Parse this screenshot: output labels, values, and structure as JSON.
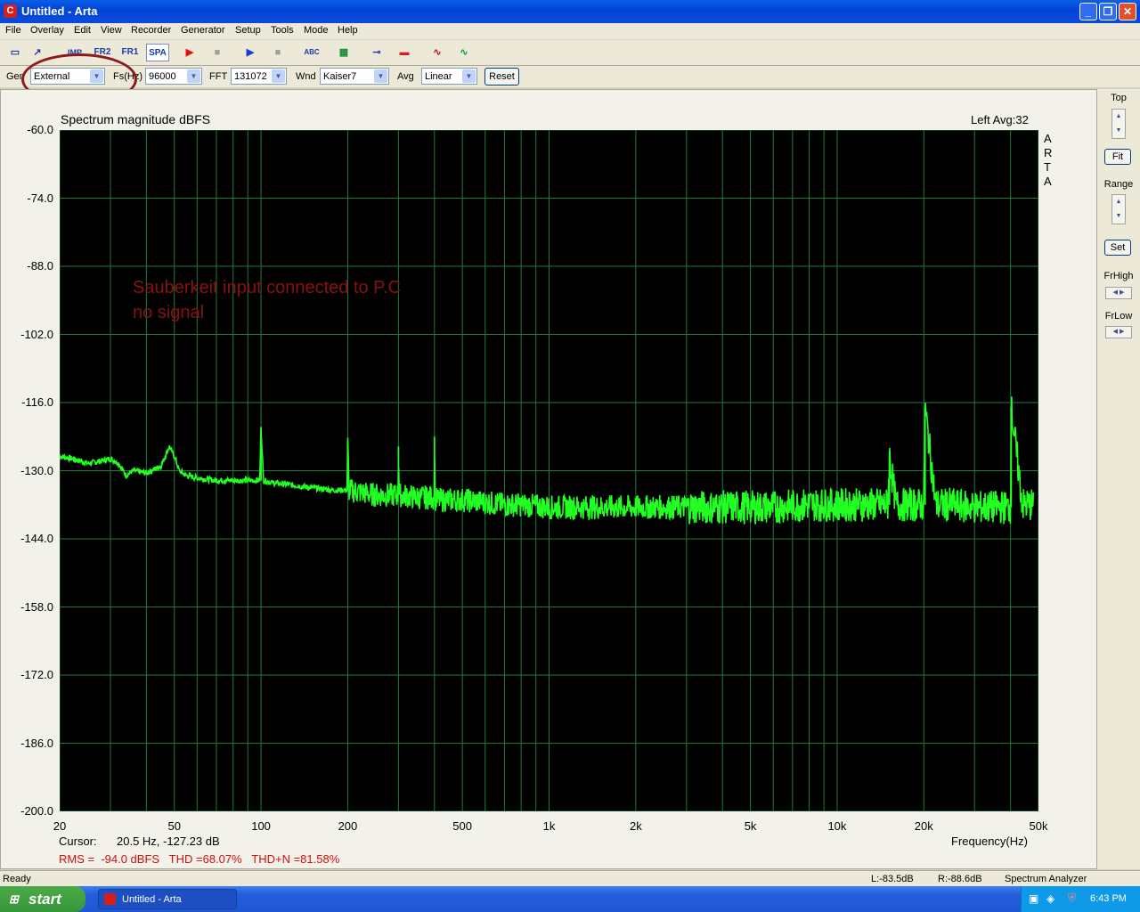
{
  "window": {
    "title": "Untitled - Arta",
    "app_icon": "C"
  },
  "menu": [
    "File",
    "Overlay",
    "Edit",
    "View",
    "Recorder",
    "Generator",
    "Setup",
    "Tools",
    "Mode",
    "Help"
  ],
  "toolbar": {
    "buttons": [
      {
        "name": "new-icon",
        "glyph": "▭"
      },
      {
        "name": "open-icon",
        "glyph": "↗"
      },
      {
        "name": "imp-button",
        "glyph": "IMP"
      },
      {
        "name": "fr2-button",
        "glyph": "FR2"
      },
      {
        "name": "fr1-button",
        "glyph": "FR1"
      },
      {
        "name": "spa-button",
        "glyph": "SPA"
      },
      {
        "name": "record-icon",
        "glyph": "▶"
      },
      {
        "name": "stop-record-icon",
        "glyph": "■"
      },
      {
        "name": "play-icon",
        "glyph": "▶"
      },
      {
        "name": "stop-icon",
        "glyph": "■"
      },
      {
        "name": "abc-icon",
        "glyph": "ABC"
      },
      {
        "name": "hatch-icon",
        "glyph": "▦"
      },
      {
        "name": "slider-icon",
        "glyph": "⊸"
      },
      {
        "name": "bar-icon",
        "glyph": "▬"
      },
      {
        "name": "waveform-icon",
        "glyph": "∿"
      },
      {
        "name": "scope-icon",
        "glyph": "∿"
      }
    ]
  },
  "controls": {
    "gen_label": "Gen",
    "gen_value": "External",
    "fs_label": "Fs(Hz)",
    "fs_value": "96000",
    "fft_label": "FFT",
    "fft_value": "131072",
    "wnd_label": "Wnd",
    "wnd_value": "Kaiser7",
    "avg_label": "Avg",
    "avg_value": "Linear",
    "reset_label": "Reset"
  },
  "plot": {
    "title": "Spectrum magnitude dBFS",
    "channel_info": "Left  Avg:32",
    "vertical_label": [
      "A",
      "R",
      "T",
      "A"
    ],
    "annotation_line1": "Sauberkeit input connected to P.C",
    "annotation_line2": "no signal",
    "cursor_label": "Cursor:",
    "cursor_value": "20.5 Hz, -127.23 dB",
    "measurements": "RMS =  -94.0 dBFS   THD =68.07%   THD+N =81.58%",
    "xlabel": "Frequency(Hz)"
  },
  "right_panel": {
    "top_label": "Top",
    "fit_label": "Fit",
    "range_label": "Range",
    "set_label": "Set",
    "frhigh_label": "FrHigh",
    "frlow_label": "FrLow"
  },
  "status": {
    "ready": "Ready",
    "left_level": "L:-83.5dB",
    "right_level": "R:-88.6dB",
    "mode": "Spectrum Analyzer"
  },
  "taskbar": {
    "start_label": "start",
    "task_label": "Untitled - Arta",
    "clock": "6:43 PM"
  },
  "colors": {
    "trace": "#22ff22",
    "grid": "#1f7a3a",
    "annotation": "#8b1010",
    "measure": "#d01010"
  },
  "chart_data": {
    "type": "line",
    "title": "Spectrum magnitude dBFS",
    "xlabel": "Frequency(Hz)",
    "ylabel": "",
    "xscale": "log",
    "xlim": [
      20,
      50000
    ],
    "ylim": [
      -200,
      -60
    ],
    "x_tick_labels": [
      "20",
      "50",
      "100",
      "200",
      "500",
      "1k",
      "2k",
      "5k",
      "10k",
      "20k",
      "50k"
    ],
    "x_ticks": [
      20,
      50,
      100,
      200,
      500,
      1000,
      2000,
      5000,
      10000,
      20000,
      50000
    ],
    "y_ticks": [
      -60,
      -74,
      -88,
      -102,
      -116,
      -130,
      -144,
      -158,
      -172,
      -186,
      -200
    ],
    "y_tick_labels": [
      "-60.0",
      "-74.0",
      "-88.0",
      "-102.0",
      "-116.0",
      "-130.0",
      "-144.0",
      "-158.0",
      "-172.0",
      "-186.0",
      "-200.0"
    ],
    "grid": true,
    "series": [
      {
        "x": [
          20,
          22,
          25,
          28,
          30,
          32,
          34,
          36,
          40,
          45,
          48,
          50,
          52,
          55,
          60,
          70,
          80,
          90,
          99,
          100,
          102,
          110,
          130,
          150,
          180,
          199,
          200,
          202,
          250,
          299,
          300,
          302,
          350,
          399,
          400,
          402,
          500,
          600,
          700,
          800,
          1000,
          1200,
          1500,
          2000,
          3000,
          4000,
          5000,
          6000,
          8000,
          10000,
          12000,
          14000,
          15000,
          15200,
          16000,
          18000,
          20000,
          20200,
          22000,
          25000,
          30000,
          35000,
          40000,
          40200,
          44000,
          48000
        ],
        "y": [
          -127,
          -127.5,
          -128.5,
          -128,
          -127.5,
          -128.5,
          -131,
          -130,
          -130.5,
          -129,
          -125,
          -127,
          -130,
          -131,
          -131.5,
          -132,
          -132,
          -132,
          -132,
          -121,
          -132,
          -132.5,
          -133,
          -133.5,
          -134,
          -134,
          -124,
          -134,
          -135,
          -135,
          -125,
          -135,
          -135.5,
          -135.5,
          -123,
          -136,
          -136,
          -136.5,
          -137,
          -137,
          -137.5,
          -137.5,
          -137.5,
          -137.5,
          -137.5,
          -137.5,
          -137.5,
          -137.5,
          -137,
          -137,
          -137,
          -137,
          -137,
          -127,
          -137,
          -137,
          -137,
          -117,
          -137,
          -137,
          -137.5,
          -137.5,
          -137.5,
          -117,
          -137,
          -137
        ]
      }
    ]
  }
}
